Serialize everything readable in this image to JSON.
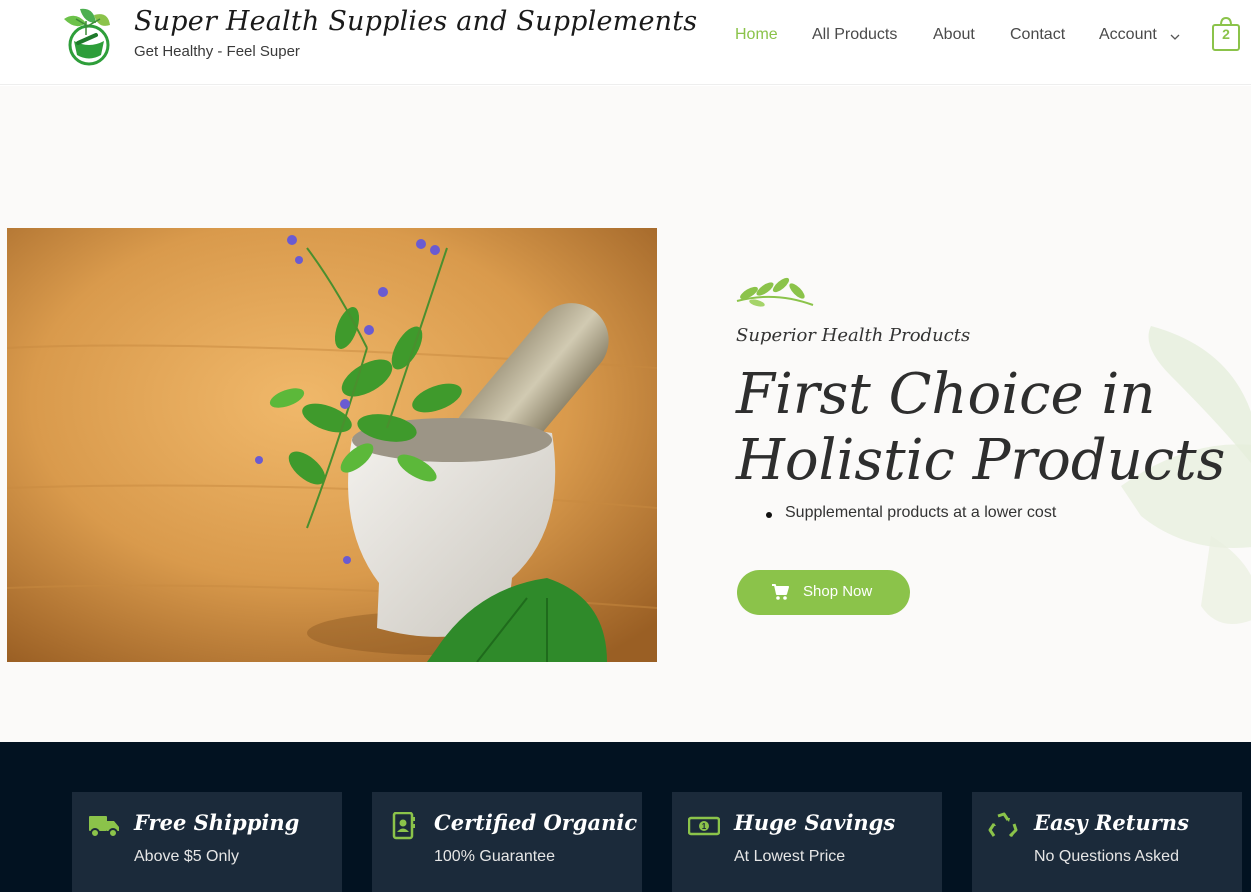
{
  "header": {
    "site_title": "Super Health Supplies and Supplements",
    "tagline": "Get Healthy - Feel Super",
    "logo_icon": "mortar-pestle-leaves-logo",
    "nav": [
      {
        "label": "Home",
        "active": true
      },
      {
        "label": "All Products",
        "active": false
      },
      {
        "label": "About",
        "active": false
      },
      {
        "label": "Contact",
        "active": false
      },
      {
        "label": "Account",
        "active": false,
        "has_dropdown": true
      }
    ],
    "cart_count": "2"
  },
  "hero": {
    "eyebrow": "Superior Health Products",
    "headline": "First Choice in Holistic Products",
    "bullets": [
      "Supplemental products at a lower cost"
    ],
    "cta_label": "Shop Now",
    "image_subject": "mortar and pestle with fresh herbs and purple flowers"
  },
  "features": [
    {
      "icon": "truck-icon",
      "title": "Free Shipping",
      "subtitle": "Above $5 Only"
    },
    {
      "icon": "address-book-icon",
      "title": "Certified Organic",
      "subtitle": "100% Guarantee"
    },
    {
      "icon": "money-bill-icon",
      "title": "Huge Savings",
      "subtitle": "At Lowest Price"
    },
    {
      "icon": "recycle-icon",
      "title": "Easy Returns",
      "subtitle": "No Questions Asked"
    }
  ],
  "colors": {
    "accent": "#8bc34a",
    "dark_band": "#021221",
    "card": "#1b2a3a",
    "hero_bg": "#fbfaf9",
    "text": "#333333"
  }
}
